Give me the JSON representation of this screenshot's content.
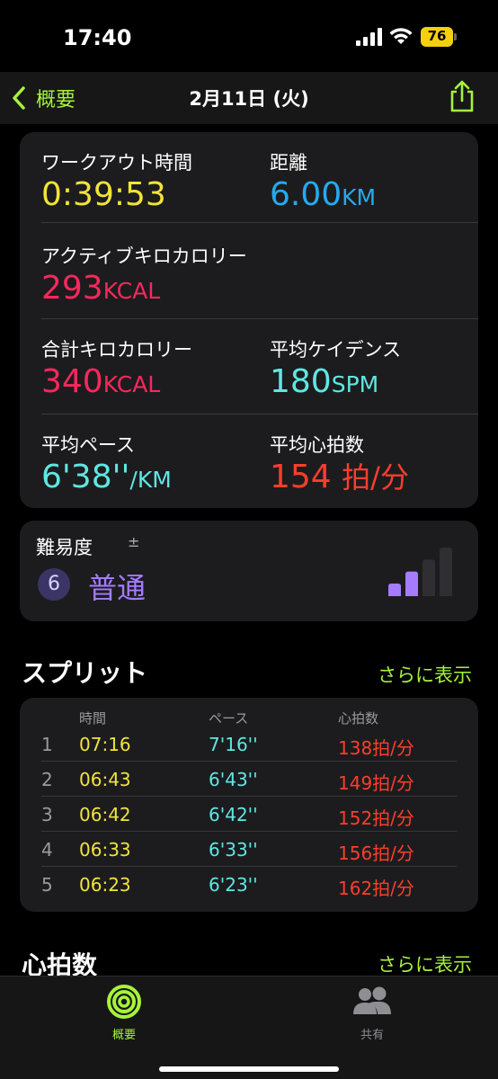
{
  "status": {
    "time": "17:40",
    "battery": "76"
  },
  "nav": {
    "back_label": "概要",
    "title": "2月11日 (火)"
  },
  "metrics": {
    "workout_time": {
      "label": "ワークアウト時間",
      "value": "0:39:53"
    },
    "distance": {
      "label": "距離",
      "value": "6.00",
      "unit": "KM"
    },
    "active_kcal": {
      "label": "アクティブキロカロリー",
      "value": "293",
      "unit": "KCAL"
    },
    "total_kcal": {
      "label": "合計キロカロリー",
      "value": "340",
      "unit": "KCAL"
    },
    "cadence": {
      "label": "平均ケイデンス",
      "value": "180",
      "unit": "SPM"
    },
    "pace": {
      "label": "平均ペース",
      "value": "6'38''",
      "unit": "/KM"
    },
    "heart_rate": {
      "label": "平均心拍数",
      "value": "154",
      "unit": "拍/分"
    }
  },
  "difficulty": {
    "label": "難易度",
    "plusminus": "±",
    "level": "6",
    "word": "普通",
    "bars_filled": 2,
    "bars_total": 4
  },
  "splits": {
    "title": "スプリット",
    "more": "さらに表示",
    "headers": {
      "time": "時間",
      "pace": "ペース",
      "hr": "心拍数"
    },
    "rows": [
      {
        "n": "1",
        "time": "07:16",
        "pace": "7'16''",
        "hr": "138拍/分"
      },
      {
        "n": "2",
        "time": "06:43",
        "pace": "6'43''",
        "hr": "149拍/分"
      },
      {
        "n": "3",
        "time": "06:42",
        "pace": "6'42''",
        "hr": "152拍/分"
      },
      {
        "n": "4",
        "time": "06:33",
        "pace": "6'33''",
        "hr": "156拍/分"
      },
      {
        "n": "5",
        "time": "06:23",
        "pace": "6'23''",
        "hr": "162拍/分"
      }
    ]
  },
  "heart_section": {
    "title": "心拍数",
    "more": "さらに表示"
  },
  "tabbar": {
    "summary": "概要",
    "sharing": "共有"
  },
  "colors": {
    "accent": "#a6f23c",
    "yellow": "#f2e33a",
    "blue": "#27a9ef",
    "pink": "#f7285c",
    "cyan": "#5fe7e3",
    "red": "#fa3e2c",
    "purple": "#a57bff"
  }
}
